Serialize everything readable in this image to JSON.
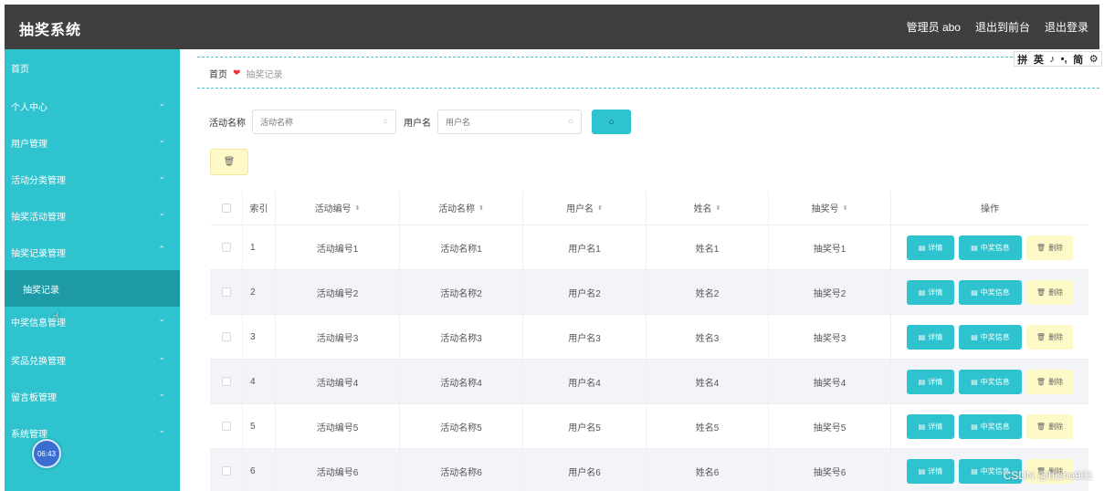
{
  "app": {
    "title": "抽奖系统"
  },
  "header": {
    "admin": "管理员 abo",
    "to_front": "退出到前台",
    "logout": "退出登录"
  },
  "sidebar": {
    "items": [
      {
        "label": "首页",
        "chevron": ""
      },
      {
        "label": "个人中心",
        "chevron": "⌄"
      },
      {
        "label": "用户管理",
        "chevron": "⌄"
      },
      {
        "label": "活动分类管理",
        "chevron": "⌄"
      },
      {
        "label": "抽奖活动管理",
        "chevron": "⌄"
      },
      {
        "label": "抽奖记录管理",
        "chevron": "⌃"
      },
      {
        "label": "抽奖记录",
        "chevron": ""
      },
      {
        "label": "中奖信息管理",
        "chevron": "⌄"
      },
      {
        "label": "奖品兑换管理",
        "chevron": "⌄"
      },
      {
        "label": "留言板管理",
        "chevron": "⌄"
      },
      {
        "label": "系统管理",
        "chevron": "⌄"
      }
    ],
    "clock": "06:43"
  },
  "breadcrumb": {
    "home": "首页",
    "deco": "❤",
    "current": "抽奖记录"
  },
  "ime": [
    "拼",
    "英",
    "♪",
    "•,",
    "简",
    "⚙"
  ],
  "search": {
    "activity_label": "活动名称",
    "activity_placeholder": "活动名称",
    "user_label": "用户名",
    "user_placeholder": "用户名",
    "search_icon": "search-icon"
  },
  "toolbar": {
    "delete_icon": "🗑"
  },
  "table": {
    "headers": [
      "索引",
      "活动编号",
      "活动名称",
      "用户名",
      "姓名",
      "抽奖号",
      "操作"
    ],
    "sort_glyph": "⬍",
    "actions": {
      "detail": "详情",
      "prize": "中奖信息",
      "delete": "删除"
    },
    "rows": [
      {
        "index": "1",
        "activity_no": "活动编号1",
        "activity_name": "活动名称1",
        "username": "用户名1",
        "name": "姓名1",
        "draw_no": "抽奖号1"
      },
      {
        "index": "2",
        "activity_no": "活动编号2",
        "activity_name": "活动名称2",
        "username": "用户名2",
        "name": "姓名2",
        "draw_no": "抽奖号2"
      },
      {
        "index": "3",
        "activity_no": "活动编号3",
        "activity_name": "活动名称3",
        "username": "用户名3",
        "name": "姓名3",
        "draw_no": "抽奖号3"
      },
      {
        "index": "4",
        "activity_no": "活动编号4",
        "activity_name": "活动名称4",
        "username": "用户名4",
        "name": "姓名4",
        "draw_no": "抽奖号4"
      },
      {
        "index": "5",
        "activity_no": "活动编号5",
        "activity_name": "活动名称5",
        "username": "用户名5",
        "name": "姓名5",
        "draw_no": "抽奖号5"
      },
      {
        "index": "6",
        "activity_no": "活动编号6",
        "activity_name": "活动名称6",
        "username": "用户名6",
        "name": "姓名6",
        "draw_no": "抽奖号6"
      }
    ]
  },
  "watermark": "CSDN @bishe901",
  "colors": {
    "accent": "#2ec3ce",
    "header": "#3f3f3f",
    "danger_bg": "#fefac8"
  }
}
